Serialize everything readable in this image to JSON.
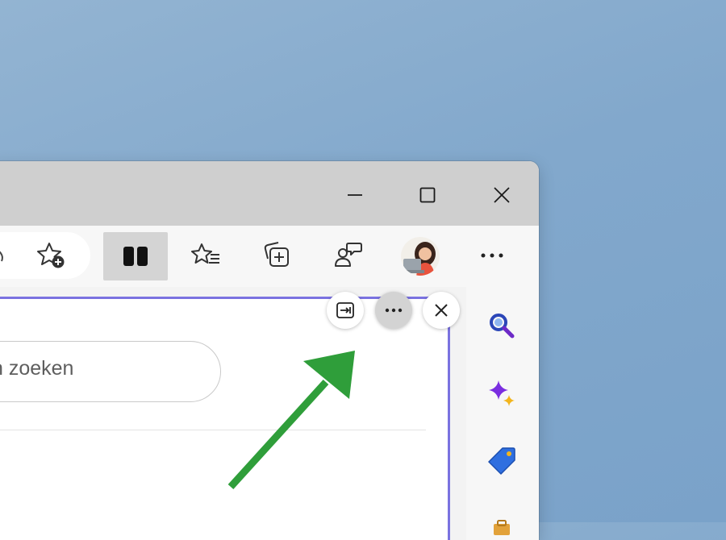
{
  "window": {
    "controls": {
      "minimize": "minimize-icon",
      "maximize": "maximize-icon",
      "close": "close-icon"
    }
  },
  "toolbar": {
    "buttons": [
      {
        "name": "read-aloud-icon"
      },
      {
        "name": "add-favorite-icon"
      },
      {
        "name": "split-screen-icon",
        "active": true
      },
      {
        "name": "favorites-icon"
      },
      {
        "name": "collections-icon"
      },
      {
        "name": "feedback-icon"
      },
      {
        "name": "profile-avatar"
      },
      {
        "name": "more-options-icon"
      }
    ]
  },
  "pane": {
    "search_text": "n zoeken",
    "header_buttons": [
      "open-in-new-tab-icon",
      "more-options-icon",
      "close-icon"
    ]
  },
  "sidebar": {
    "items": [
      "search-icon",
      "copilot-icon",
      "shopping-tag-icon",
      "tools-icon"
    ]
  },
  "colors": {
    "desktop": "#86aacd",
    "titlebar": "#cfcfcf",
    "active_pane_border": "#7a72e0",
    "arrow": "#2f9e3a",
    "search_icon": "#2b46b8",
    "copilot_icon": "#7a2de0",
    "tag_icon": "#2f6fe0"
  }
}
